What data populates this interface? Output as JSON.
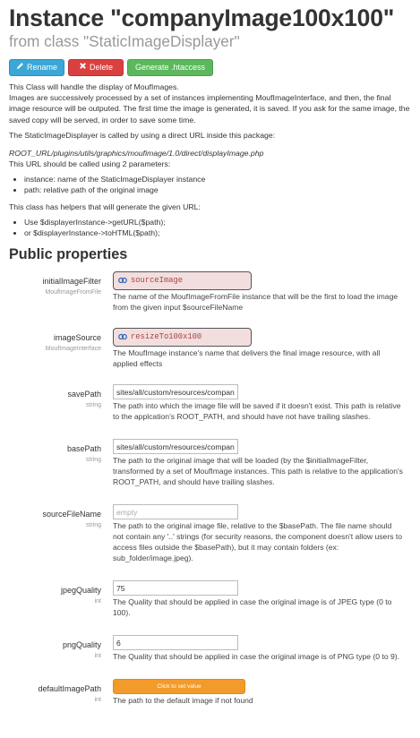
{
  "header": {
    "title": "Instance \"companyImage100x100\"",
    "subtitle": "from class \"StaticImageDisplayer\""
  },
  "toolbar": {
    "rename_label": "Rename",
    "delete_label": "Delete",
    "generate_label": "Generate .htaccess",
    "colors": {
      "rename": "#3ba7d6",
      "delete": "#d9403f",
      "generate": "#5cb85c"
    }
  },
  "description": {
    "p1_line1": "This Class will handle the display of MoufImages.",
    "p1_line2": "Images are successively processed by a set of instances implementing MoufImageInterface, and then, the final image resource will be outputed. The first time the image is generated, it is saved. If you ask for the same image, the saved copy will be served, in order to save some time.",
    "p2": "The StaticImageDisplayer is called by using a direct URL inside this package:",
    "url": "ROOT_URL/plugins/utils/graphics/moufimage/1.0/direct/displayImage.php",
    "p3": "This URL should be called using 2 parameters:",
    "params": [
      "instance: name of the StaticImageDisplayer instance",
      "path: relative path of the original image"
    ],
    "p4": "This class has helpers that will generate the given URL:",
    "helpers": [
      "Use $displayerInstance->getURL($path);",
      "or $displayerInstance->toHTML($path);"
    ]
  },
  "properties": {
    "heading": "Public properties",
    "initialImageFilter": {
      "name": "initialImageFilter",
      "type": "MoufImageFromFile",
      "value": "sourceImage",
      "desc": "The name of the MoufImageFromFile instance that will be the first to load the image from the given input $sourceFileName"
    },
    "imageSource": {
      "name": "imageSource",
      "type": "MoufImageInterface",
      "value": "resizeTo100x100",
      "desc": "The MoufImage instance's name that delivers the final image resource, with all applied effects"
    },
    "savePath": {
      "name": "savePath",
      "type": "string",
      "value": "sites/all/custom/resources/company_images",
      "desc": "The path into which the image file will be saved if it doesn't exist. This path is relative to the applcation's ROOT_PATH, and should have not have trailing slashes."
    },
    "basePath": {
      "name": "basePath",
      "type": "string",
      "value": "sites/all/custom/resources/company_images",
      "desc": "The path to the original image that will be loaded (by the $initialImageFilter, transformed by a set of MoufImage instances. This path is relative to the application's ROOT_PATH, and should have trailing slashes."
    },
    "sourceFileName": {
      "name": "sourceFileName",
      "type": "string",
      "placeholder": "empty",
      "desc": "The path to the original image file, relative to the $basePath. The file name should not contain any '..' strings (for security reasons, the component doesn't allow users to access files outside the $basePath), but it may contain folders (ex: sub_folder/image.jpeg)."
    },
    "jpegQuality": {
      "name": "jpegQuality",
      "type": "int",
      "value": "75",
      "desc": "The Quality that should be applied in case the original image is of JPEG type (0 to 100)."
    },
    "pngQuality": {
      "name": "pngQuality",
      "type": "int",
      "value": "6",
      "desc": "The Quality that should be applied in case the original image is of PNG type (0 to 9)."
    },
    "defaultImagePath": {
      "name": "defaultImagePath",
      "type": "int",
      "button_label": "Click to set value",
      "desc": "The path to the default image if not found"
    }
  }
}
